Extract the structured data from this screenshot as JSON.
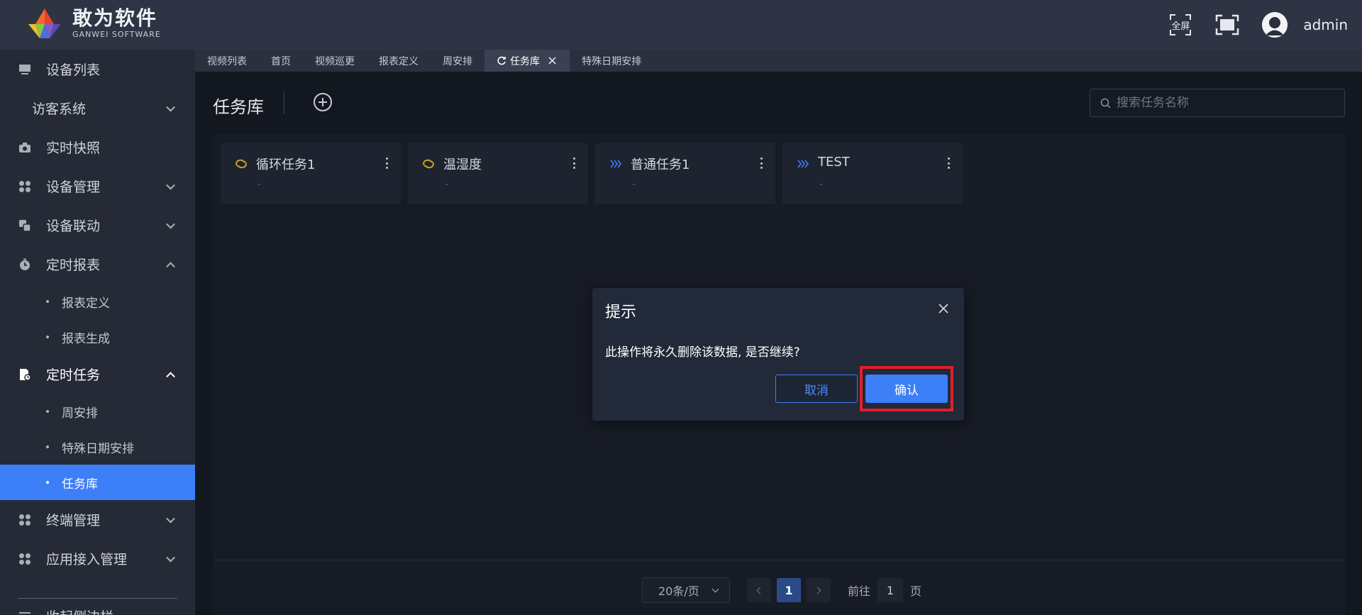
{
  "header": {
    "brand_cn": "敢为软件",
    "brand_en": "GANWEI SOFTWARE",
    "fullscreen_text": "全屏",
    "username": "admin"
  },
  "tabs": [
    {
      "label": "视频列表",
      "active": false
    },
    {
      "label": "首页",
      "active": false
    },
    {
      "label": "视频巡更",
      "active": false
    },
    {
      "label": "报表定义",
      "active": false
    },
    {
      "label": "周安排",
      "active": false
    },
    {
      "label": "任务库",
      "active": true
    },
    {
      "label": "特殊日期安排",
      "active": false
    }
  ],
  "sidebar": {
    "items": [
      {
        "label": "设备列表",
        "icon": "monitor-icon"
      },
      {
        "label": "访客系统",
        "icon": ""
      },
      {
        "label": "实时快照",
        "icon": "camera-icon"
      },
      {
        "label": "设备管理",
        "icon": "grid-icon"
      },
      {
        "label": "设备联动",
        "icon": "link-icon"
      },
      {
        "label": "定时报表",
        "icon": "stopwatch-icon"
      },
      {
        "label": "报表定义"
      },
      {
        "label": "报表生成"
      },
      {
        "label": "定时任务",
        "icon": "task-file-icon"
      },
      {
        "label": "周安排"
      },
      {
        "label": "特殊日期安排"
      },
      {
        "label": "任务库"
      },
      {
        "label": "终端管理",
        "icon": "grid-icon"
      },
      {
        "label": "应用接入管理",
        "icon": "grid-icon"
      },
      {
        "label": "收起侧边栏"
      }
    ]
  },
  "main": {
    "title": "任务库",
    "search_placeholder": "搜索任务名称",
    "cards": [
      {
        "name": "循环任务1",
        "desc": "-",
        "icon": "loop-icon"
      },
      {
        "name": "温湿度",
        "desc": "-",
        "icon": "loop-icon"
      },
      {
        "name": "普通任务1",
        "desc": "-",
        "icon": "chevrons-icon"
      },
      {
        "name": "TEST",
        "desc": "-",
        "icon": "chevrons-icon"
      }
    ],
    "pagination": {
      "page_size": "20条/页",
      "current_page": "1",
      "goto_prefix": "前往",
      "goto_value": "1",
      "goto_suffix": "页"
    }
  },
  "dialog": {
    "title": "提示",
    "message": "此操作将永久删除该数据, 是否继续?",
    "cancel_label": "取消",
    "confirm_label": "确认"
  },
  "colors": {
    "accent": "#3d7ff7",
    "highlight": "#e0202a",
    "loop_icon": "#c9a227",
    "chevrons_icon": "#3d7ff7"
  }
}
